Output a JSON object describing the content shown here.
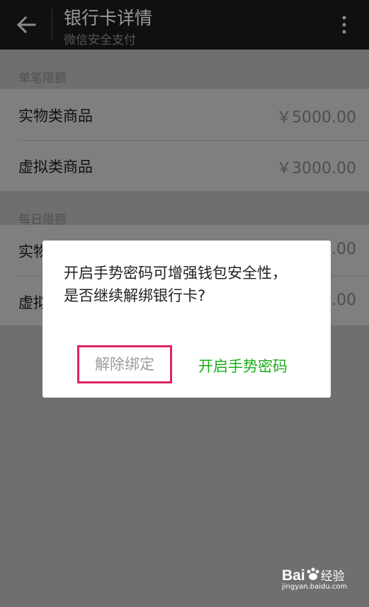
{
  "header": {
    "title": "银行卡详情",
    "subtitle": "微信安全支付",
    "back_icon": "back-arrow-icon",
    "more_icon": "more-vertical-icon"
  },
  "single_limit": {
    "title": "单笔限额",
    "rows": [
      {
        "label": "实物类商品",
        "value": "￥5000.00"
      },
      {
        "label": "虚拟类商品",
        "value": "￥3000.00"
      }
    ]
  },
  "daily_limit": {
    "title": "每日限额",
    "rows": [
      {
        "label": "实物",
        "value": ".00"
      },
      {
        "label": "虚拟",
        "value": ".00"
      }
    ]
  },
  "dialog": {
    "message": "开启手势密码可增强钱包安全性，是否继续解绑银行卡?",
    "unbind_label": "解除绑定",
    "enable_gesture_label": "开启手势密码"
  },
  "watermark": {
    "brand": "Bai",
    "brand_suffix": "经验",
    "site": "jingyan.baidu.com"
  },
  "colors": {
    "accent_green": "#1aad19",
    "highlight_pink": "#e0245e"
  }
}
